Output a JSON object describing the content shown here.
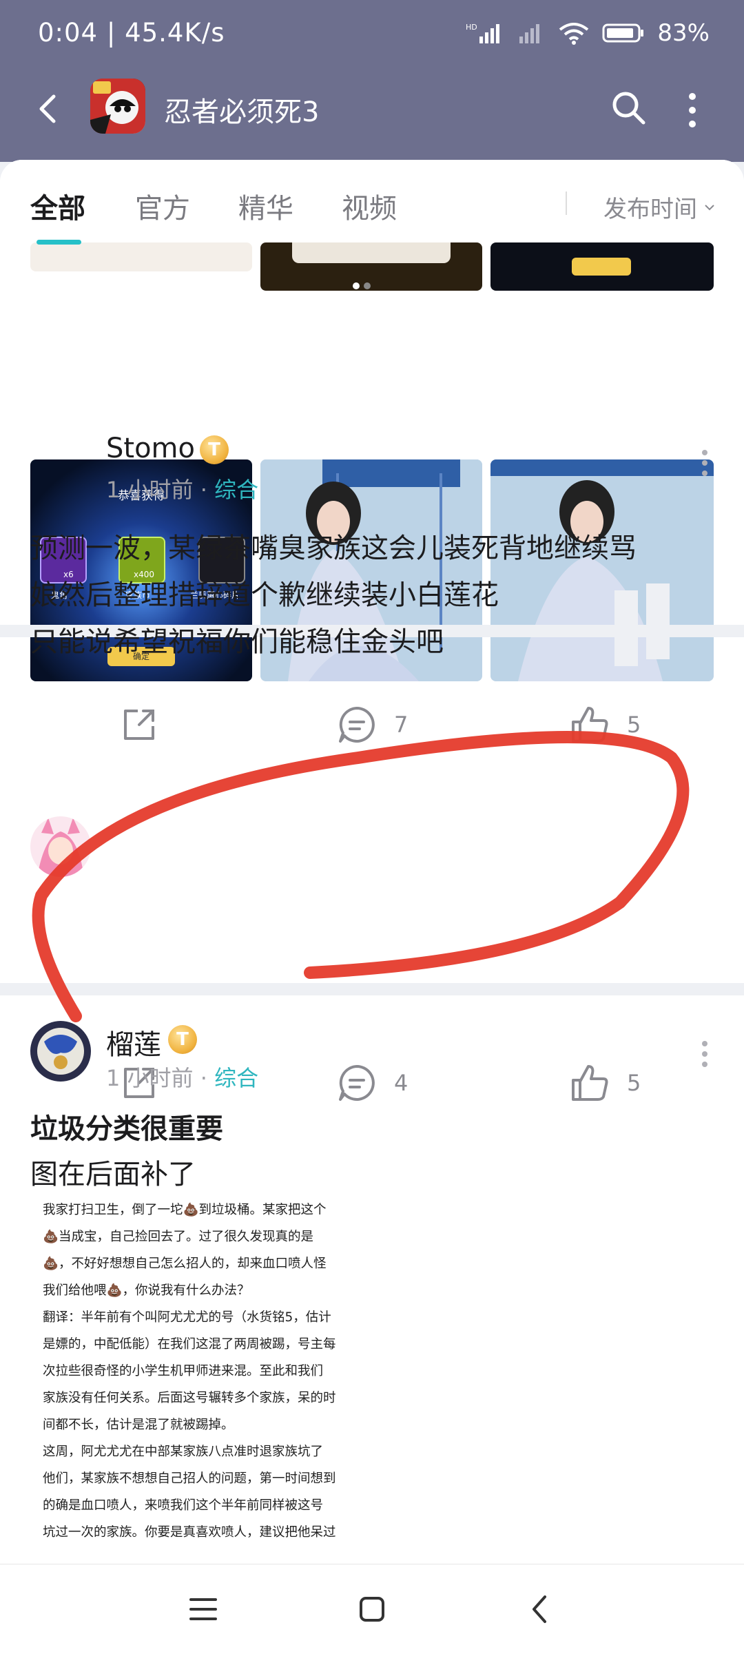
{
  "status_bar": {
    "time": "0:04 | 45.4K/s",
    "battery": "83%"
  },
  "app_bar": {
    "title": "忍者必须死3"
  },
  "tabs": [
    {
      "label": "全部"
    },
    {
      "label": "官方"
    },
    {
      "label": "精华"
    },
    {
      "label": "视频"
    }
  ],
  "sort_label": "发布时间",
  "colors": {
    "header": "#6d6f8e",
    "accent": "#26c0c8",
    "annotation_red": "#e53b2c"
  },
  "image_post": {
    "reward_title": "恭喜获得",
    "reward_items": [
      {
        "name": "鬼角",
        "qty": "x6"
      },
      {
        "name": "家族币",
        "qty": "x400"
      },
      {
        "name": "兰质蕙心碎片",
        "qty": ""
      }
    ],
    "confirm_label": "确定",
    "comments": "7",
    "likes": "5"
  },
  "post1": {
    "username": "Stomo",
    "level": "T",
    "time": "1 小时前",
    "category": "综合",
    "lines": [
      "预测一波，某绿茶嘴臭家族这会儿装死背地继续骂",
      "娘然后整理措辞道个歉继续装小白莲花",
      "只能说希望祝福你们能稳住金头吧"
    ],
    "comments": "4",
    "likes": "5"
  },
  "post2": {
    "username": "榴莲",
    "level": "T",
    "time": "1 小时前",
    "category": "综合",
    "title": "垃圾分类很重要",
    "subtitle": "图在后面补了",
    "image_lines": [
      "我家打扫卫生，倒了一坨💩到垃圾桶。某家把这个",
      "💩当成宝，自己捡回去了。过了很久发现真的是",
      "💩，不好好想想自己怎么招人的，却来血口喷人怪",
      "我们给他喂💩，你说我有什么办法？",
      "翻译：半年前有个叫阿尤尤尤的号（水货铭5，估计",
      "是嫖的，中配低能）在我们这混了两周被踢，号主每",
      "次拉些很奇怪的小学生机甲师进来混。至此和我们",
      "家族没有任何关系。后面这号辗转多个家族，呆的时",
      "间都不长，估计是混了就被踢掉。",
      "这周，阿尤尤尤在中部某家族八点准时退家族坑了",
      "他们，某家族不想想自己招人的问题，第一时间想到",
      "的确是血口喷人，来喷我们这个半年前同样被这号",
      "坑过一次的家族。你要是真喜欢喷人，建议把他呆过"
    ]
  }
}
